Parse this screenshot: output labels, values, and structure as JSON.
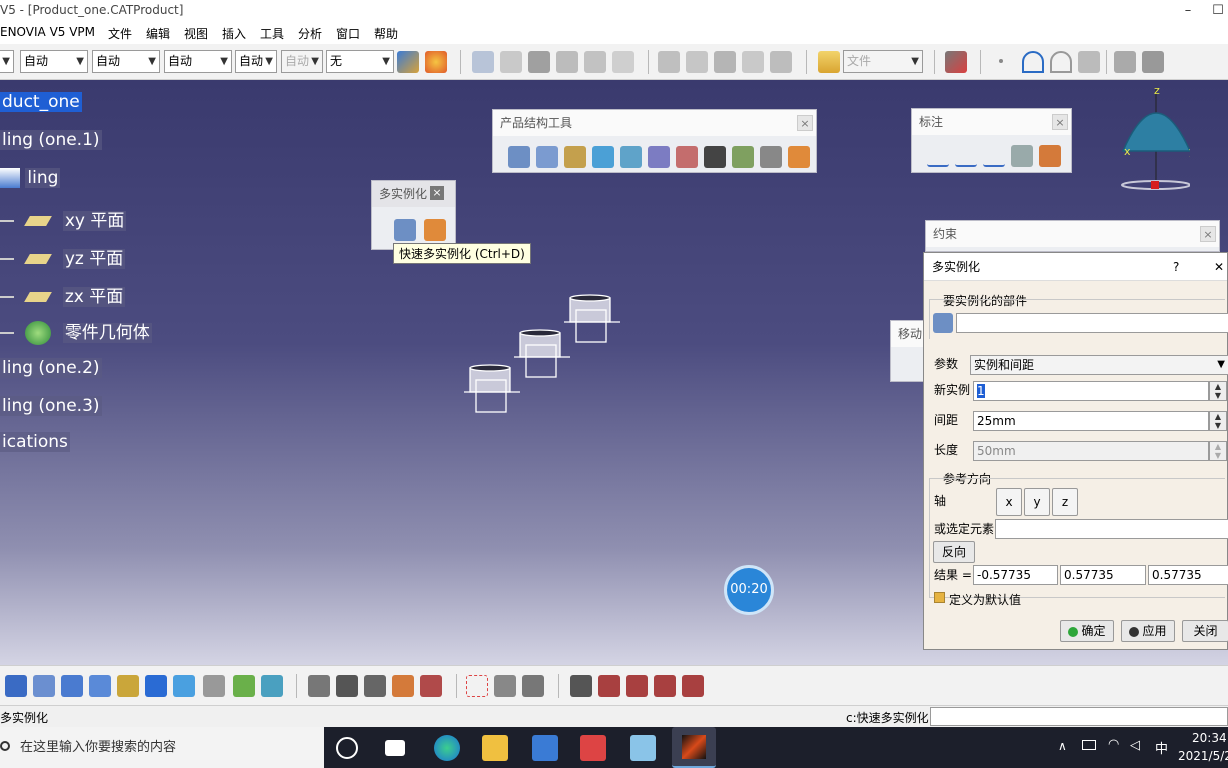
{
  "window": {
    "title": "V5 - [Product_one.CATProduct]",
    "min": "–",
    "max": "☐"
  },
  "menu": [
    "ENOVIA V5 VPM",
    "文件",
    "编辑",
    "视图",
    "插入",
    "工具",
    "分析",
    "窗口",
    "帮助"
  ],
  "toolbar": {
    "combos": [
      "自动",
      "自动",
      "自动",
      "自动",
      "自动",
      "无"
    ],
    "file_combo": "文件"
  },
  "tree": {
    "root": "duct_one",
    "items": [
      "ling (one.1)",
      "ling",
      "xy 平面",
      "yz 平面",
      "zx 平面",
      "零件几何体",
      "ling (one.2)",
      "ling (one.3)",
      "ications"
    ]
  },
  "panels": {
    "product_tools": "产品结构工具",
    "annotation": "标注",
    "multi_instance": "多实例化",
    "constraint": "约束",
    "move": "移动",
    "close": "×"
  },
  "tooltip": "快速多实例化 (Ctrl+D)",
  "timer": "00:20",
  "compass": {
    "x": "x",
    "y": "y",
    "z": "z"
  },
  "dialog": {
    "title": "多实例化",
    "help": "?",
    "close": "✕",
    "part_group": "要实例化的部件",
    "part_value": "",
    "param_label": "参数",
    "param_value": "实例和间距",
    "new_instance_label": "新实例",
    "new_instance_value": "1",
    "spacing_label": "间距",
    "spacing_value": "25mm",
    "length_label": "长度",
    "length_value": "50mm",
    "ref_group": "参考方向",
    "axis_label": "轴",
    "axis_buttons": [
      "x",
      "y",
      "z"
    ],
    "select_label": "或选定元素",
    "select_value": "",
    "reverse": "反向",
    "result_label": "结果 =",
    "results": [
      "-0.57735",
      "0.57735",
      "0.57735"
    ],
    "default_check": "定义为默认值",
    "ok": "确定",
    "apply": "应用",
    "close_btn": "关闭"
  },
  "status": {
    "left": "多实例化",
    "prompt": "c:快速多实例化"
  },
  "taskbar": {
    "search": "在这里输入你要搜索的内容",
    "time": "20:34",
    "date": "2021/5/2",
    "ime": "中"
  }
}
